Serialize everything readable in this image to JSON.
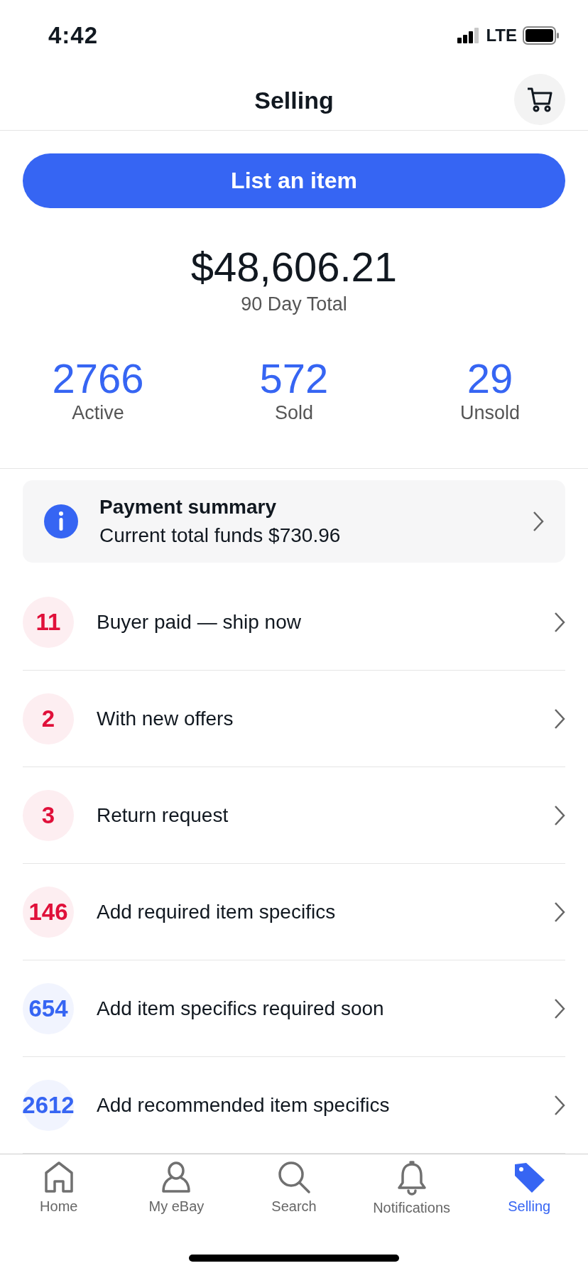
{
  "status_bar": {
    "time": "4:42",
    "network": "LTE"
  },
  "header": {
    "title": "Selling"
  },
  "primary_button": {
    "label": "List an item"
  },
  "summary": {
    "total": "$48,606.21",
    "total_label": "90 Day Total",
    "stats": [
      {
        "count": "2766",
        "label": "Active"
      },
      {
        "count": "572",
        "label": "Sold"
      },
      {
        "count": "29",
        "label": "Unsold"
      }
    ]
  },
  "payment_card": {
    "title": "Payment summary",
    "subtitle": "Current total funds $730.96"
  },
  "tasks": [
    {
      "count": "11",
      "label": "Buyer paid — ship now",
      "color": "#e0103a"
    },
    {
      "count": "2",
      "label": "With new offers",
      "color": "#e0103a"
    },
    {
      "count": "3",
      "label": "Return request",
      "color": "#e0103a"
    },
    {
      "count": "146",
      "label": "Add required item specifics",
      "color": "#e0103a"
    },
    {
      "count": "654",
      "label": "Add item specifics required soon",
      "color": "#3665f3"
    },
    {
      "count": "2612",
      "label": "Add recommended item specifics",
      "color": "#3665f3"
    }
  ],
  "tab_bar": [
    {
      "kind": "home",
      "label": "Home",
      "selected": false
    },
    {
      "kind": "person",
      "label": "My eBay",
      "selected": false
    },
    {
      "kind": "search",
      "label": "Search",
      "selected": false
    },
    {
      "kind": "bell",
      "label": "Notifications",
      "selected": false
    },
    {
      "kind": "tag",
      "label": "Selling",
      "selected": true
    }
  ]
}
